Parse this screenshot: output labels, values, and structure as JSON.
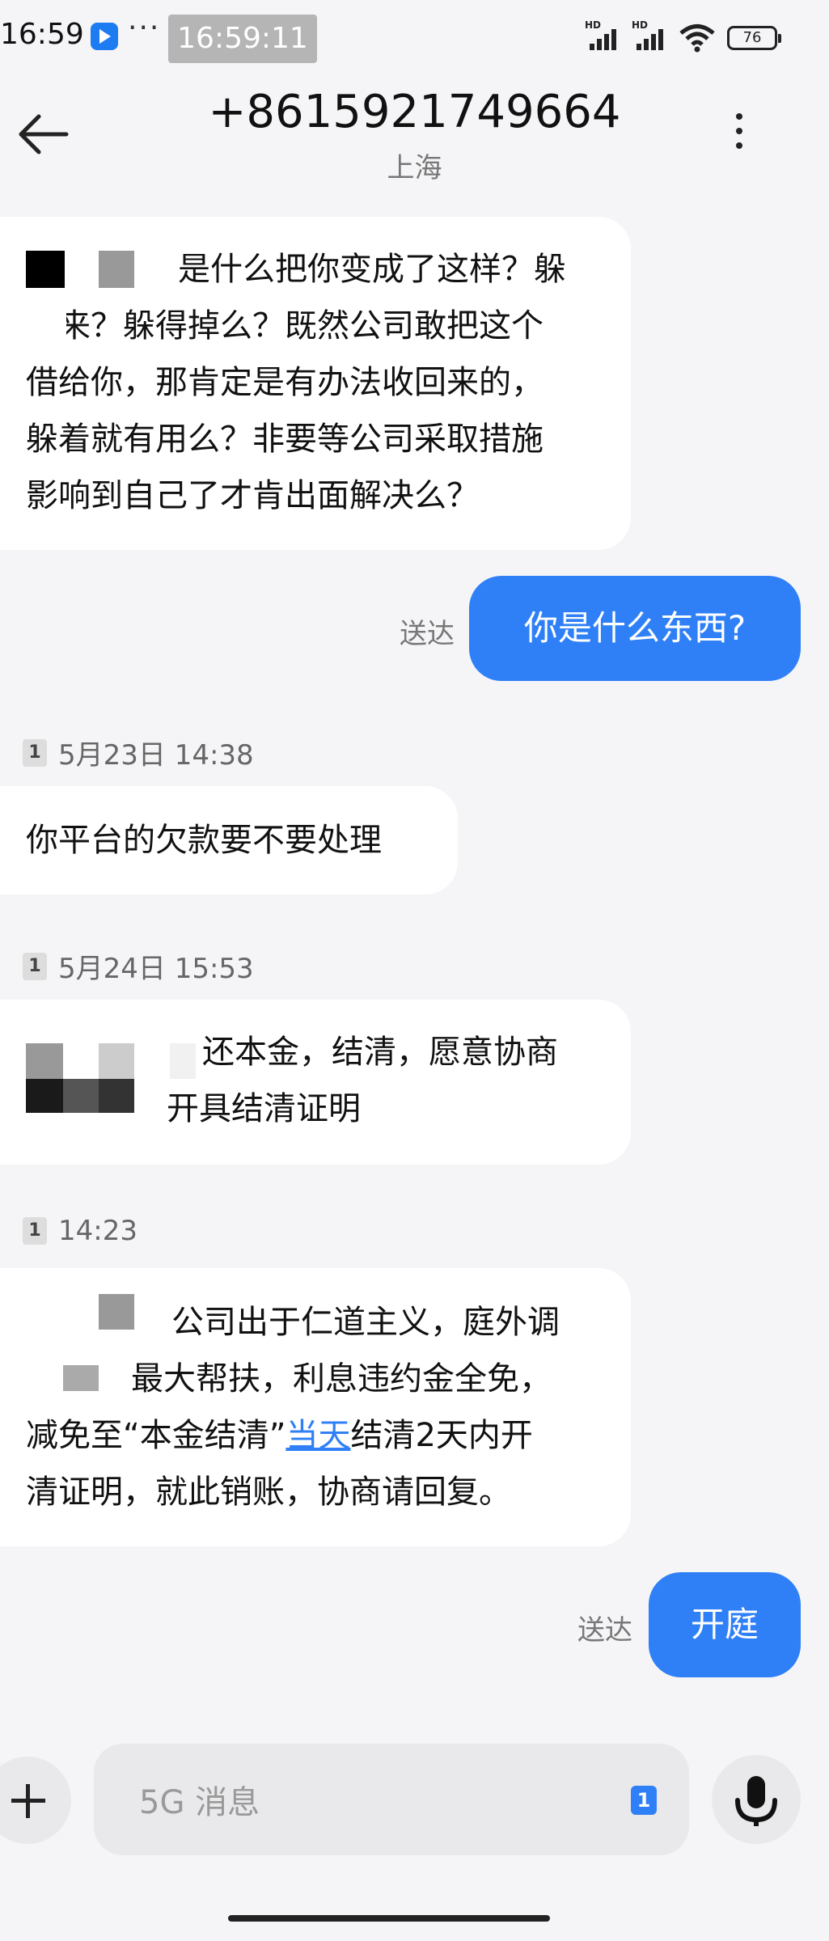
{
  "status_bar": {
    "time": "16:59",
    "more": "···",
    "clock_badge": "16:59:11",
    "hd1": "HD",
    "hd2": "HD",
    "battery": "76"
  },
  "header": {
    "title": "+8615921749664",
    "subtitle": "上海"
  },
  "messages": [
    {
      "type": "in",
      "lines": [
        "是什么把你变成了这样？躲",
        "起来？躲得掉么？既然公司敢把这个",
        "借给你，那肯定是有办法收回来的，",
        "躲着就有用么？非要等公司采取措施",
        "影响到自己了才肯出面解决么？"
      ]
    },
    {
      "type": "out",
      "text": "你是什么东西?",
      "status": "送达"
    },
    {
      "type": "date",
      "sim": "1",
      "text": "5月23日 14:38"
    },
    {
      "type": "in",
      "lines": [
        "你平台的欠款要不要处理"
      ]
    },
    {
      "type": "date",
      "sim": "1",
      "text": "5月24日 15:53"
    },
    {
      "type": "in",
      "lines": [
        "还本金，结清，愿意协商",
        "开具结清证明"
      ]
    },
    {
      "type": "date",
      "sim": "1",
      "text": "14:23"
    },
    {
      "type": "in",
      "lines": [
        "公司出于仁道主义，庭外调",
        "最大帮扶，利息违约金全免，",
        "减免至“本金结清”",
        "清证明，就此销账，协商请回复。"
      ],
      "link_text": "当天",
      "after_link": "结清2天内开"
    },
    {
      "type": "out",
      "text": "开庭",
      "status": "送达"
    }
  ],
  "input": {
    "placeholder": "5G 消息",
    "sim": "1"
  },
  "icons": {
    "back": "arrow-left-icon",
    "more": "more-vertical-icon",
    "plus": "plus-icon",
    "mic": "microphone-icon"
  },
  "colors": {
    "accent": "#2f80f7",
    "background": "#f5f5f7",
    "bubble_in": "#ffffff"
  }
}
